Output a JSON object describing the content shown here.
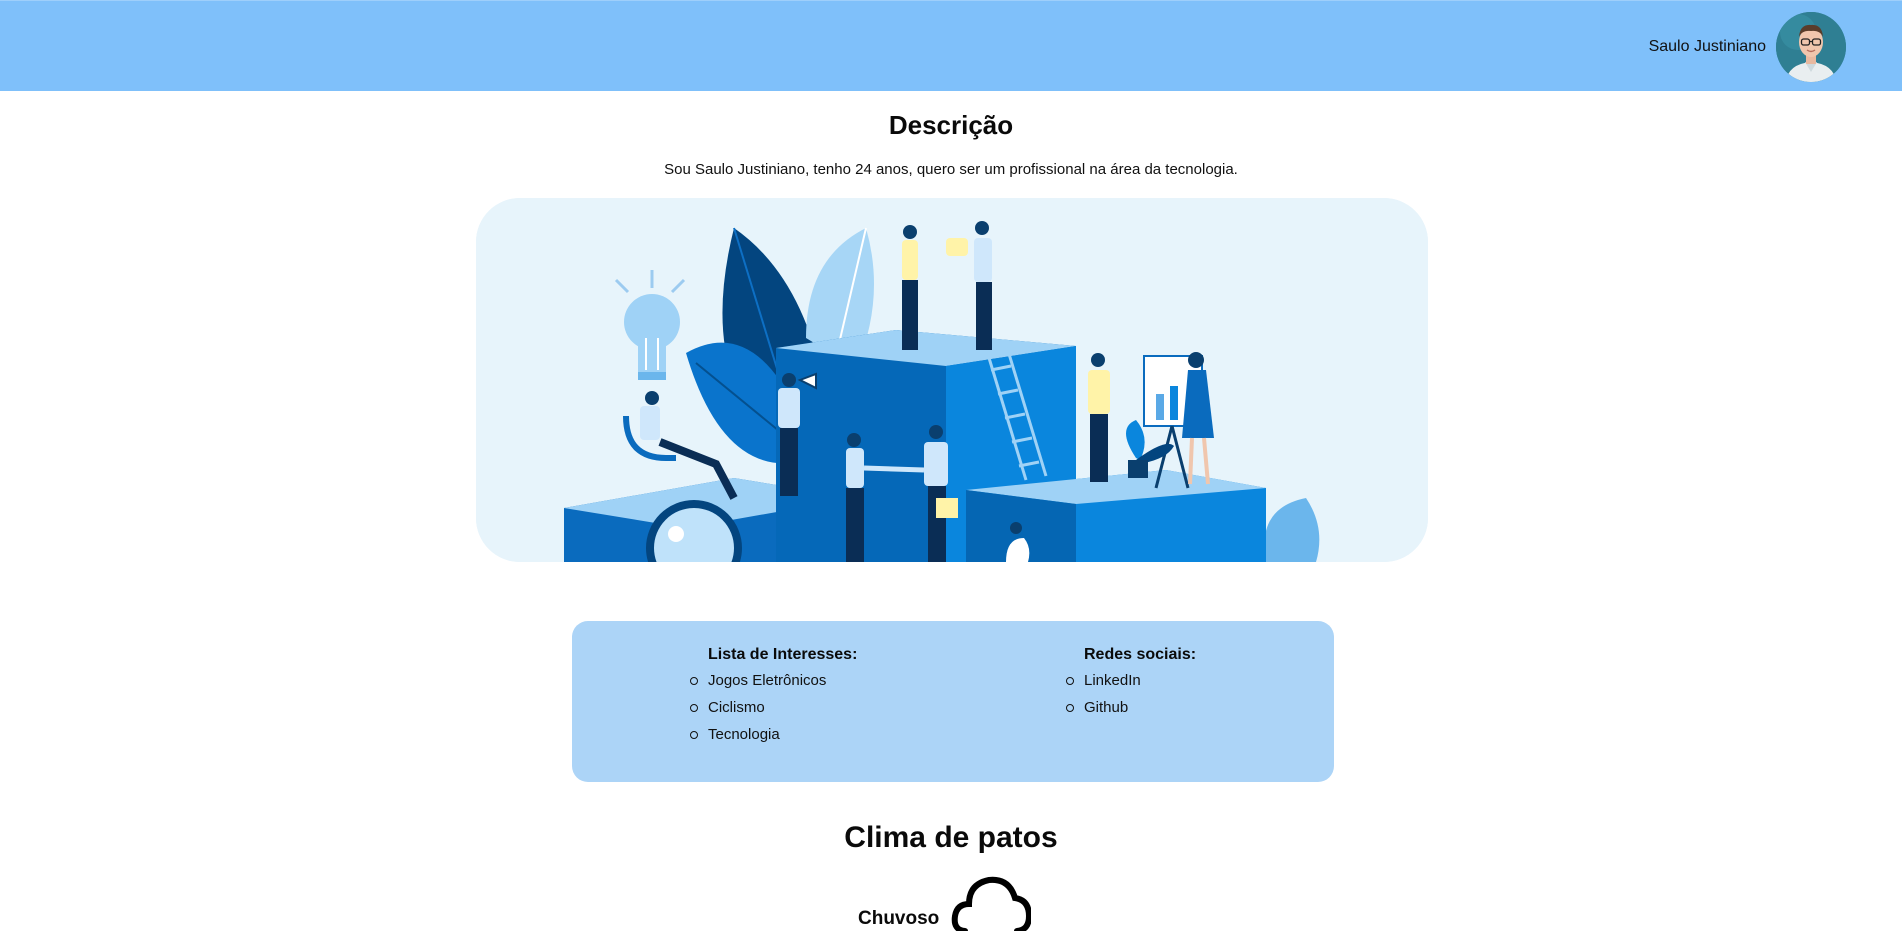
{
  "header": {
    "user_name": "Saulo Justiniano",
    "avatar_icon": "profile-photo",
    "bg_color": "#7fc0fa"
  },
  "description": {
    "title": "Descrição",
    "text": "Sou Saulo Justiniano, tenho 24 anos, quero ser um profissional na área da tecnologia."
  },
  "hero": {
    "icon": "team-illustration"
  },
  "interests": {
    "title": "Lista de Interesses:",
    "items": [
      "Jogos Eletrônicos",
      "Ciclismo",
      "Tecnologia"
    ]
  },
  "social": {
    "title": "Redes sociais:",
    "items": [
      "LinkedIn",
      "Github"
    ]
  },
  "weather": {
    "title": "Clima de patos",
    "status": "Chuvoso",
    "icon": "cloud-icon"
  }
}
